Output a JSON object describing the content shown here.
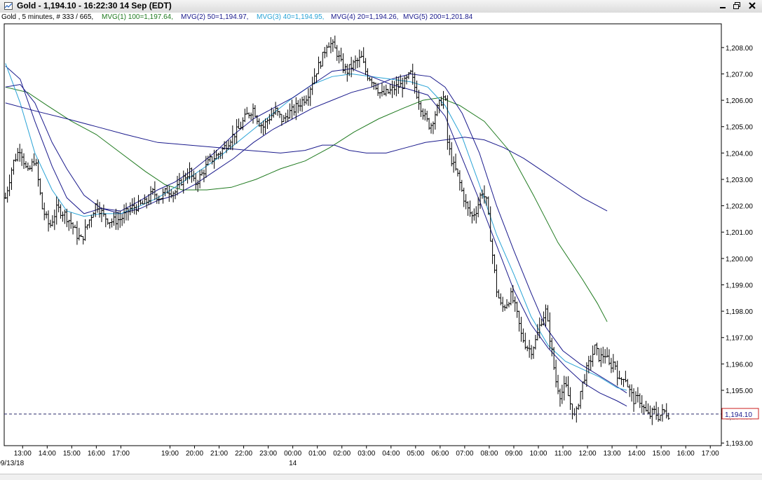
{
  "window": {
    "title": "Gold - 1,194.10 - 16:22:30  14 Sep (EDT)",
    "buttons": [
      "minimize",
      "maximize",
      "close"
    ]
  },
  "study_line": [
    {
      "text": "Gold , 5 minutes, # 333 / 665,",
      "color": "#000000"
    },
    {
      "text": "MVG(1) 100=1,197.64,",
      "color": "#1f7a1f"
    },
    {
      "text": "MVG(2) 50=1,194.97,",
      "color": "#1a1a8c"
    },
    {
      "text": "MVG(3) 40=1,194.95,",
      "color": "#29a3d6"
    },
    {
      "text": "MVG(4) 20=1,194.26,",
      "color": "#1a1a8c"
    },
    {
      "text": "MVG(5) 200=1,201.84",
      "color": "#1a1a8c"
    }
  ],
  "chart_data": {
    "type": "ohlc",
    "instrument": "Gold",
    "interval": "5 minutes",
    "last_price": "1,194.10",
    "last_price_value": 1194.1,
    "ylim": [
      1192.9,
      1208.9
    ],
    "yticks": [
      1193,
      1194,
      1195,
      1196,
      1197,
      1198,
      1199,
      1200,
      1201,
      1202,
      1203,
      1204,
      1205,
      1206,
      1207,
      1208
    ],
    "ytick_labels": [
      "1,193.00",
      "1,194.00",
      "1,195.00",
      "1,196.00",
      "1,197.00",
      "1,198.00",
      "1,199.00",
      "1,200.00",
      "1,201.00",
      "1,202.00",
      "1,203.00",
      "1,204.00",
      "1,205.00",
      "1,206.00",
      "1,207.00",
      "1,208.00"
    ],
    "xlim": [
      12.25,
      41.45
    ],
    "xticks": [
      13,
      14,
      15,
      16,
      17,
      19,
      20,
      21,
      22,
      23,
      24,
      25,
      26,
      27,
      28,
      29,
      30,
      31,
      32,
      33,
      34,
      35,
      36,
      37,
      38,
      39,
      40,
      41
    ],
    "xtick_labels": [
      "13:00",
      "14:00",
      "15:00",
      "16:00",
      "17:00",
      "19:00",
      "20:00",
      "21:00",
      "22:00",
      "23:00",
      "00:00",
      "01:00",
      "02:00",
      "03:00",
      "04:00",
      "05:00",
      "06:00",
      "07:00",
      "08:00",
      "09:00",
      "10:00",
      "11:00",
      "12:00",
      "13:00",
      "14:00",
      "15:00",
      "16:00",
      "17:00"
    ],
    "date_labels": [
      {
        "x": 12.5,
        "text": "09/13/18"
      },
      {
        "x": 24,
        "text": "14"
      }
    ],
    "grid": false,
    "close_path": [
      [
        12.3,
        1202.3
      ],
      [
        12.6,
        1203.6
      ],
      [
        12.9,
        1204.2
      ],
      [
        13.2,
        1203.2
      ],
      [
        13.5,
        1203.8
      ],
      [
        13.8,
        1201.9
      ],
      [
        14.1,
        1201.2
      ],
      [
        14.4,
        1201.9
      ],
      [
        14.7,
        1201.7
      ],
      [
        15.0,
        1201.3
      ],
      [
        15.2,
        1200.9
      ],
      [
        15.4,
        1200.7
      ],
      [
        15.6,
        1201.2
      ],
      [
        16.0,
        1202.1
      ],
      [
        16.3,
        1201.6
      ],
      [
        16.6,
        1201.4
      ],
      [
        17.0,
        1201.5
      ],
      [
        17.2,
        1201.7
      ],
      [
        17.4,
        1201.9
      ],
      [
        18.0,
        1202.1
      ],
      [
        18.3,
        1202.5
      ],
      [
        18.6,
        1202.3
      ],
      [
        18.9,
        1202.6
      ],
      [
        19.2,
        1202.5
      ],
      [
        19.5,
        1203.0
      ],
      [
        19.8,
        1203.3
      ],
      [
        20.0,
        1202.8
      ],
      [
        20.3,
        1203.2
      ],
      [
        20.6,
        1203.7
      ],
      [
        20.9,
        1203.9
      ],
      [
        21.2,
        1204.2
      ],
      [
        21.5,
        1204.6
      ],
      [
        21.8,
        1204.9
      ],
      [
        22.1,
        1205.4
      ],
      [
        22.4,
        1205.7
      ],
      [
        22.6,
        1205.2
      ],
      [
        22.8,
        1205.0
      ],
      [
        23.0,
        1205.3
      ],
      [
        23.3,
        1205.6
      ],
      [
        23.6,
        1205.2
      ],
      [
        23.8,
        1205.5
      ],
      [
        24.0,
        1205.6
      ],
      [
        24.3,
        1205.9
      ],
      [
        24.6,
        1206.2
      ],
      [
        24.9,
        1207.0
      ],
      [
        25.2,
        1207.6
      ],
      [
        25.4,
        1208.2
      ],
      [
        25.6,
        1208.1
      ],
      [
        25.8,
        1207.8
      ],
      [
        26.0,
        1207.3
      ],
      [
        26.2,
        1207.1
      ],
      [
        26.5,
        1207.4
      ],
      [
        26.8,
        1207.6
      ],
      [
        27.0,
        1207.0
      ],
      [
        27.3,
        1206.7
      ],
      [
        27.6,
        1206.2
      ],
      [
        27.9,
        1206.3
      ],
      [
        28.2,
        1206.5
      ],
      [
        28.5,
        1206.6
      ],
      [
        28.8,
        1207.0
      ],
      [
        29.0,
        1206.4
      ],
      [
        29.2,
        1205.8
      ],
      [
        29.4,
        1205.3
      ],
      [
        29.6,
        1205.0
      ],
      [
        29.8,
        1205.5
      ],
      [
        30.0,
        1205.9
      ],
      [
        30.2,
        1206.2
      ],
      [
        30.3,
        1204.4
      ],
      [
        30.5,
        1203.6
      ],
      [
        30.7,
        1203.2
      ],
      [
        30.9,
        1202.5
      ],
      [
        31.1,
        1201.9
      ],
      [
        31.3,
        1201.6
      ],
      [
        31.5,
        1201.9
      ],
      [
        31.7,
        1202.6
      ],
      [
        31.9,
        1202.1
      ],
      [
        32.1,
        1200.4
      ],
      [
        32.3,
        1198.8
      ],
      [
        32.5,
        1198.1
      ],
      [
        32.7,
        1198.3
      ],
      [
        32.9,
        1198.6
      ],
      [
        33.1,
        1198.0
      ],
      [
        33.3,
        1197.1
      ],
      [
        33.5,
        1196.7
      ],
      [
        33.7,
        1196.5
      ],
      [
        33.9,
        1196.9
      ],
      [
        34.1,
        1197.6
      ],
      [
        34.3,
        1198.0
      ],
      [
        34.5,
        1196.8
      ],
      [
        34.7,
        1195.4
      ],
      [
        34.9,
        1194.8
      ],
      [
        35.1,
        1195.2
      ],
      [
        35.3,
        1194.5
      ],
      [
        35.5,
        1193.9
      ],
      [
        35.7,
        1194.9
      ],
      [
        35.9,
        1195.6
      ],
      [
        36.1,
        1196.1
      ],
      [
        36.3,
        1196.6
      ],
      [
        36.5,
        1196.2
      ],
      [
        36.7,
        1196.4
      ],
      [
        36.9,
        1195.9
      ],
      [
        37.1,
        1196.1
      ],
      [
        37.3,
        1195.3
      ],
      [
        37.5,
        1195.6
      ],
      [
        37.7,
        1195.0
      ],
      [
        37.9,
        1194.6
      ],
      [
        38.1,
        1194.7
      ],
      [
        38.3,
        1194.3
      ],
      [
        38.5,
        1194.0
      ],
      [
        38.7,
        1194.2
      ],
      [
        38.9,
        1194.0
      ],
      [
        39.1,
        1194.2
      ],
      [
        39.3,
        1194.1
      ]
    ],
    "series": [
      {
        "name": "MVG(1) 100",
        "color": "#1f7a1f",
        "points": [
          [
            12.3,
            1206.5
          ],
          [
            13.2,
            1206.3
          ],
          [
            14.0,
            1205.8
          ],
          [
            15.0,
            1205.2
          ],
          [
            16.0,
            1204.7
          ],
          [
            17.0,
            1204.0
          ],
          [
            18.0,
            1203.3
          ],
          [
            18.8,
            1202.8
          ],
          [
            19.5,
            1202.6
          ],
          [
            20.5,
            1202.6
          ],
          [
            21.5,
            1202.7
          ],
          [
            22.5,
            1203.0
          ],
          [
            23.5,
            1203.4
          ],
          [
            24.5,
            1203.7
          ],
          [
            25.5,
            1204.2
          ],
          [
            26.5,
            1204.8
          ],
          [
            27.5,
            1205.3
          ],
          [
            28.5,
            1205.7
          ],
          [
            29.3,
            1206.0
          ],
          [
            30.0,
            1206.1
          ],
          [
            30.8,
            1205.8
          ],
          [
            31.8,
            1205.2
          ],
          [
            32.8,
            1204.1
          ],
          [
            33.8,
            1202.4
          ],
          [
            34.8,
            1200.6
          ],
          [
            35.8,
            1199.2
          ],
          [
            36.4,
            1198.3
          ],
          [
            36.8,
            1197.6
          ]
        ]
      },
      {
        "name": "MVG(2) 50",
        "color": "#1a1a8c",
        "points": [
          [
            12.3,
            1207.3
          ],
          [
            12.9,
            1206.8
          ],
          [
            13.5,
            1205.2
          ],
          [
            14.2,
            1203.5
          ],
          [
            14.8,
            1202.3
          ],
          [
            15.5,
            1201.7
          ],
          [
            16.2,
            1201.9
          ],
          [
            17.0,
            1201.7
          ],
          [
            17.8,
            1201.9
          ],
          [
            18.5,
            1202.2
          ],
          [
            19.2,
            1202.4
          ],
          [
            20.0,
            1202.8
          ],
          [
            20.8,
            1203.3
          ],
          [
            21.6,
            1203.8
          ],
          [
            22.4,
            1204.4
          ],
          [
            23.2,
            1204.9
          ],
          [
            24.0,
            1205.3
          ],
          [
            24.8,
            1205.7
          ],
          [
            25.6,
            1206.0
          ],
          [
            26.4,
            1206.3
          ],
          [
            27.2,
            1206.5
          ],
          [
            28.0,
            1206.8
          ],
          [
            28.8,
            1207.0
          ],
          [
            29.6,
            1206.9
          ],
          [
            30.2,
            1206.5
          ],
          [
            30.9,
            1205.5
          ],
          [
            31.6,
            1204.0
          ],
          [
            32.3,
            1202.0
          ],
          [
            33.0,
            1200.3
          ],
          [
            33.7,
            1198.7
          ],
          [
            34.3,
            1197.4
          ],
          [
            35.0,
            1196.5
          ],
          [
            35.7,
            1196.0
          ],
          [
            36.4,
            1195.6
          ],
          [
            37.1,
            1195.2
          ],
          [
            37.6,
            1194.9
          ]
        ]
      },
      {
        "name": "MVG(3) 40",
        "color": "#29a3d6",
        "points": [
          [
            12.3,
            1207.4
          ],
          [
            12.9,
            1205.9
          ],
          [
            13.5,
            1204.0
          ],
          [
            14.2,
            1202.6
          ],
          [
            14.8,
            1201.8
          ],
          [
            15.5,
            1201.6
          ],
          [
            16.2,
            1201.7
          ],
          [
            17.0,
            1201.7
          ],
          [
            17.8,
            1202.0
          ],
          [
            18.5,
            1202.3
          ],
          [
            19.2,
            1202.7
          ],
          [
            20.0,
            1203.2
          ],
          [
            20.8,
            1203.7
          ],
          [
            21.6,
            1204.3
          ],
          [
            22.4,
            1204.9
          ],
          [
            23.2,
            1205.5
          ],
          [
            24.0,
            1206.1
          ],
          [
            24.8,
            1206.6
          ],
          [
            25.6,
            1206.9
          ],
          [
            26.4,
            1207.0
          ],
          [
            27.2,
            1206.9
          ],
          [
            28.0,
            1206.8
          ],
          [
            28.8,
            1206.7
          ],
          [
            29.5,
            1206.5
          ],
          [
            30.2,
            1205.8
          ],
          [
            30.9,
            1204.6
          ],
          [
            31.6,
            1202.8
          ],
          [
            32.3,
            1200.9
          ],
          [
            33.0,
            1199.4
          ],
          [
            33.7,
            1197.8
          ],
          [
            34.4,
            1196.7
          ],
          [
            35.1,
            1196.1
          ],
          [
            35.8,
            1195.8
          ],
          [
            36.5,
            1195.5
          ],
          [
            37.2,
            1195.1
          ],
          [
            37.6,
            1195.0
          ]
        ]
      },
      {
        "name": "MVG(4) 20",
        "color": "#1a1a8c",
        "points": [
          [
            12.3,
            1206.5
          ],
          [
            12.9,
            1206.6
          ],
          [
            13.5,
            1205.9
          ],
          [
            14.2,
            1204.4
          ],
          [
            14.8,
            1203.4
          ],
          [
            15.5,
            1202.4
          ],
          [
            16.2,
            1201.9
          ],
          [
            17.0,
            1201.8
          ],
          [
            17.8,
            1202.2
          ],
          [
            18.5,
            1202.6
          ],
          [
            19.2,
            1202.9
          ],
          [
            20.0,
            1203.4
          ],
          [
            20.8,
            1204.0
          ],
          [
            21.6,
            1204.7
          ],
          [
            22.4,
            1205.3
          ],
          [
            23.2,
            1205.7
          ],
          [
            24.0,
            1206.1
          ],
          [
            24.8,
            1206.6
          ],
          [
            25.6,
            1207.1
          ],
          [
            26.4,
            1207.2
          ],
          [
            27.2,
            1206.9
          ],
          [
            28.0,
            1206.6
          ],
          [
            28.8,
            1206.4
          ],
          [
            29.5,
            1206.2
          ],
          [
            30.2,
            1205.4
          ],
          [
            30.9,
            1203.8
          ],
          [
            31.6,
            1202.2
          ],
          [
            32.3,
            1200.5
          ],
          [
            33.0,
            1198.8
          ],
          [
            33.7,
            1197.5
          ],
          [
            34.4,
            1196.6
          ],
          [
            35.1,
            1195.9
          ],
          [
            35.8,
            1195.3
          ],
          [
            36.5,
            1194.9
          ],
          [
            37.2,
            1194.6
          ],
          [
            37.6,
            1194.4
          ]
        ]
      },
      {
        "name": "MVG(5) 200",
        "color": "#1a1a8c",
        "points": [
          [
            12.3,
            1205.9
          ],
          [
            13.5,
            1205.6
          ],
          [
            14.8,
            1205.3
          ],
          [
            16.0,
            1205.0
          ],
          [
            17.2,
            1204.7
          ],
          [
            18.5,
            1204.4
          ],
          [
            19.8,
            1204.3
          ],
          [
            21.0,
            1204.2
          ],
          [
            22.2,
            1204.1
          ],
          [
            23.5,
            1204.0
          ],
          [
            24.5,
            1204.1
          ],
          [
            25.2,
            1204.3
          ],
          [
            25.7,
            1204.3
          ],
          [
            26.3,
            1204.1
          ],
          [
            27.0,
            1204.0
          ],
          [
            27.8,
            1204.0
          ],
          [
            28.6,
            1204.2
          ],
          [
            29.4,
            1204.4
          ],
          [
            30.2,
            1204.5
          ],
          [
            31.0,
            1204.6
          ],
          [
            31.8,
            1204.5
          ],
          [
            32.6,
            1204.2
          ],
          [
            33.4,
            1203.8
          ],
          [
            34.2,
            1203.3
          ],
          [
            35.0,
            1202.8
          ],
          [
            35.8,
            1202.3
          ],
          [
            36.8,
            1201.8
          ]
        ]
      }
    ]
  }
}
